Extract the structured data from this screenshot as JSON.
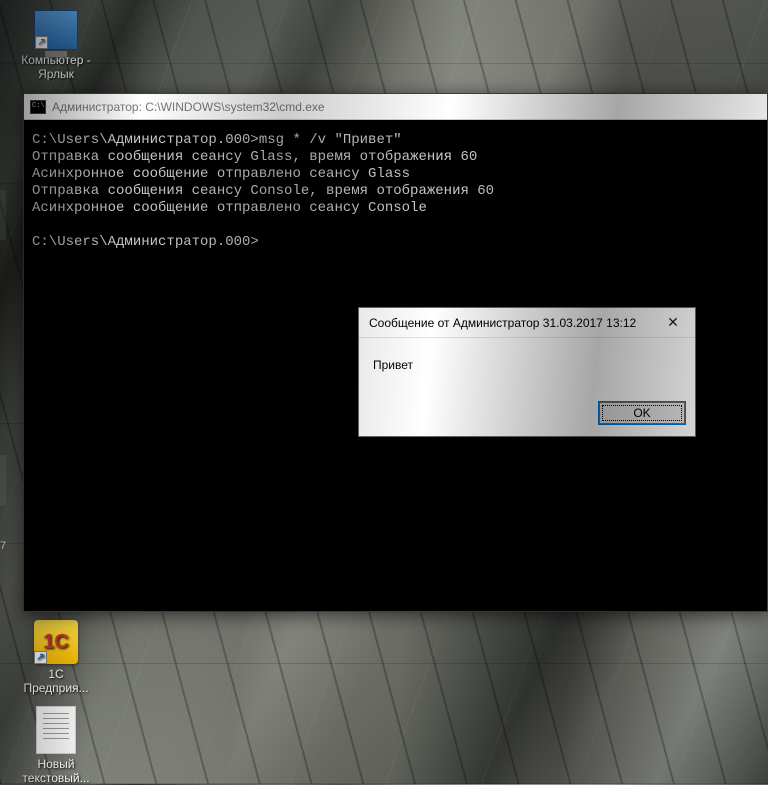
{
  "desktop": {
    "icons": [
      {
        "label": "Компьютер - Ярлык"
      },
      {
        "label": "1С Предприя...",
        "badge": "1C"
      },
      {
        "label": "Новый текстовый..."
      }
    ]
  },
  "cmd": {
    "title": "Администратор: C:\\WINDOWS\\system32\\cmd.exe",
    "lines": [
      "C:\\Users\\Администратор.000>msg * /v \"Привет\"",
      "Отправка сообщения сеансу Glass, время отображения 60",
      "Асинхронное сообщение отправлено сеансу Glass",
      "Отправка сообщения сеансу Console, время отображения 60",
      "Асинхронное сообщение отправлено сеансу Console",
      "",
      "C:\\Users\\Администратор.000>"
    ]
  },
  "msgbox": {
    "title": "Сообщение от Администратор 31.03.2017 13:12",
    "body": "Привет",
    "close": "✕",
    "ok": "OK"
  }
}
